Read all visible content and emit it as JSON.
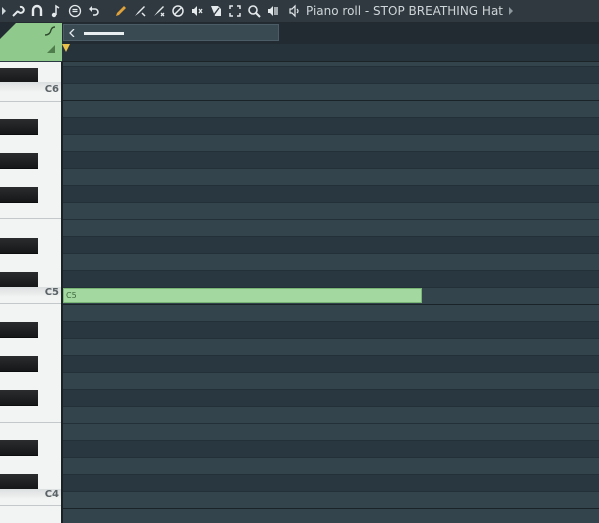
{
  "window": {
    "title": "Piano roll - STOP BREATHING Hat"
  },
  "toolbar": {
    "icons": [
      "menu-arrow-icon",
      "wrench-icon",
      "magnet-icon",
      "note-icon",
      "stamp-icon",
      "undo-icon",
      "pencil-icon",
      "paint-brush-icon",
      "delete-brush-icon",
      "mute-circle-icon",
      "mute-speaker-icon",
      "slice-icon",
      "select-icon",
      "zoom-icon",
      "playback-icon",
      "speaker-icon",
      "forward-arrow-icon"
    ]
  },
  "keyboard": {
    "octaves": [
      {
        "label": "C6"
      },
      {
        "label": "C5"
      },
      {
        "label": "C4"
      }
    ]
  },
  "notes": [
    {
      "pitch": "C5",
      "label": "C5"
    }
  ],
  "colors": {
    "note_fill": "#a3d8a1",
    "accent_tab": "#8fc98b",
    "grid_bg": "#2e3e46",
    "marker": "#e8c04a"
  }
}
